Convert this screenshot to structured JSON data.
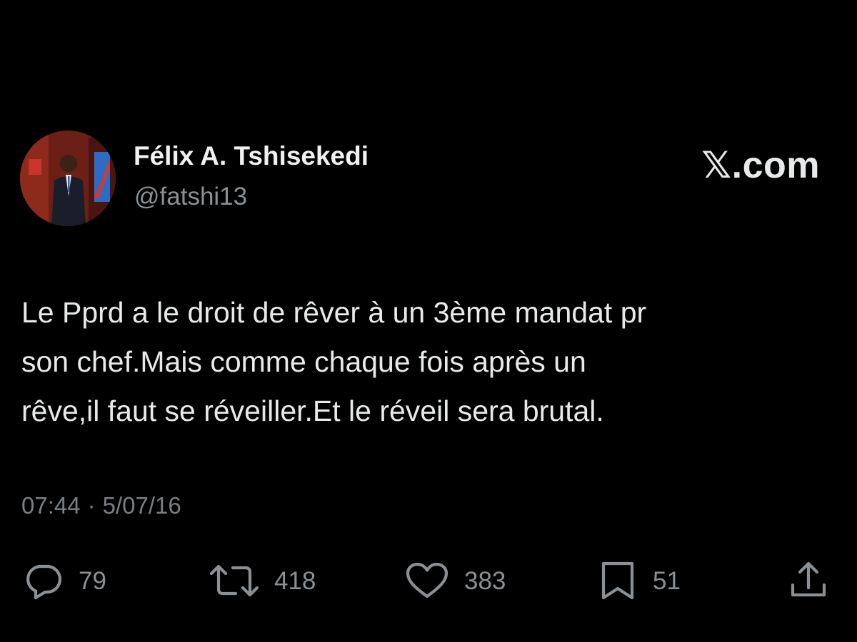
{
  "author": {
    "name": "Félix A. Tshisekedi",
    "handle": "@fatshi13",
    "avatar_icon": "profile-photo"
  },
  "brand": {
    "logo_text": "𝕏.com"
  },
  "tweet": {
    "lines": [
      "Le Pprd a le droit de rêver à un 3ème mandat pr",
      "son chef.Mais comme chaque fois après un",
      "rêve,il faut se réveiller.Et le réveil sera brutal."
    ],
    "time": "07:44",
    "separator": "·",
    "date": "5/07/16"
  },
  "actions": {
    "replies": "79",
    "reposts": "418",
    "likes": "383",
    "bookmarks": "51"
  },
  "icons": {
    "reply": "speech-bubble-icon",
    "repost": "repost-arrows-icon",
    "like": "heart-icon",
    "bookmark": "bookmark-icon",
    "share": "share-upload-icon"
  },
  "colors": {
    "background": "#000000",
    "text_primary": "#e7e9ea",
    "text_secondary": "#8b9095"
  }
}
